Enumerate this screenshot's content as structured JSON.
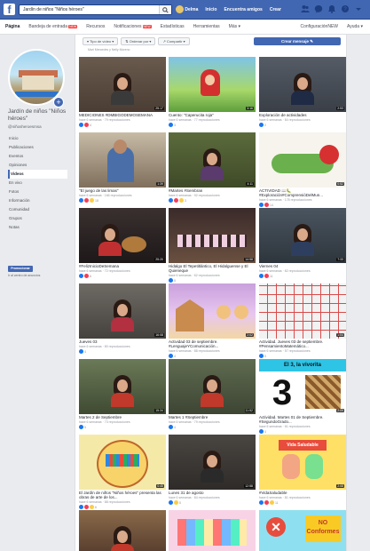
{
  "topbar": {
    "search_value": "Jardín de niños \"Niños héroes\"",
    "nav": [
      "Delma",
      "Inicio",
      "Encuentra amigos",
      "Crear"
    ],
    "icons": [
      "friends-icon",
      "messages-icon",
      "notifications-icon",
      "help-icon",
      "menu-icon"
    ]
  },
  "pagebar": {
    "tabs": [
      "Página",
      "Bandeja de entrada",
      "Recursos",
      "Notificaciones",
      "Estadísticas",
      "Herramientas",
      "Más"
    ],
    "new_label": "NEW",
    "right": [
      "Configuración",
      "Ayuda"
    ]
  },
  "sidebar": {
    "page_name": "Jardín de niños \"Niños héroes\"",
    "handle": "@niñosheroesmsa",
    "menu": [
      "Inicio",
      "Publicaciones",
      "Eventos",
      "Opiniones",
      "Videos",
      "En vivo",
      "Fotos",
      "Información",
      "Comunidad",
      "Grupos",
      "Notas"
    ],
    "active_index": 4,
    "promote_label": "Promocionar",
    "promote_note": "Ir al centro de anuncios"
  },
  "main": {
    "filter_labels": [
      "Tipo de vídeo",
      "Ordenar por",
      "Compartir"
    ],
    "create_label": "Crear mensaje",
    "top_caption": "Mari Mercedes y Nelly Moreno"
  },
  "videos": [
    {
      "title": "MEDICIONES #DMBIGODEMOSEMANA",
      "meta": "hace 6 semanas · 79 reproducciones",
      "dur": "25:17",
      "reacts": "4"
    },
    {
      "title": "Cuento: \"Caperucita roja\"",
      "meta": "hace 6 semanas · 77 reproducciones",
      "dur": "3:16",
      "reacts": "3"
    },
    {
      "title": "Exploración de actividades",
      "meta": "hace 6 semanas · 84 reproducciones",
      "dur": "2:53",
      "reacts": "2"
    },
    {
      "title": "\"El juego de las limas\"",
      "meta": "hace 6 semanas · 166 reproducciones",
      "dur": "1:39",
      "reacts": "18"
    },
    {
      "title": "#Martes #Sembran",
      "meta": "hace 6 semanas · 92 reproducciones",
      "dur": "4:11",
      "reacts": "3"
    },
    {
      "title": "ACTIVIDAD 📖🐛 #Exploración#ComprensióDelMun...",
      "meta": "hace 6 semanas · 178 reproducciones",
      "dur": "0:52",
      "reacts": "14"
    },
    {
      "title": "#FelizInicioDeSemana",
      "meta": "hace 6 semanas · 72 reproducciones",
      "dur": "25:20",
      "reacts": "6"
    },
    {
      "title": "Hidalgo El Tepetitlántico, El Hidalguense y El Quieneque",
      "meta": "hace 6 semanas · 62 reproducciones",
      "dur": "14:58",
      "reacts": "5"
    },
    {
      "title": "Viernes 04",
      "meta": "hace 6 semanas · 82 reproducciones",
      "dur": "7:33",
      "reacts": "11"
    },
    {
      "title": "Jueves 03",
      "meta": "hace 6 semanas · 80 reproducciones",
      "dur": "16:08",
      "reacts": "4"
    },
    {
      "title": "Actividad 03 de septiembre. #LenguajeYComunicación...",
      "meta": "hace 6 semanas · 88 reproducciones",
      "dur": "2:02",
      "reacts": "4"
    },
    {
      "title": "Actividad. Jueves 03 de septiembre. #PensamientoMatemático...",
      "meta": "hace 6 semanas · 57 reproducciones",
      "dur": "1:04",
      "reacts": "5"
    },
    {
      "title": "Martes 2 de Septiembre",
      "meta": "hace 6 semanas · 73 reproducciones",
      "dur": "15:34",
      "reacts": "5"
    },
    {
      "title": "Martes 1 #Septiembre",
      "meta": "hace 6 semanas · 79 reproducciones",
      "dur": "11:52",
      "reacts": "4"
    },
    {
      "title": "Actividad. Martes 01 de Septiembre. #SegundoGrado...",
      "meta": "hace 6 semanas · 61 reproducciones",
      "dur": "2:09",
      "reacts": "4",
      "thumb_text": [
        "El 3, la vivorita",
        "3"
      ]
    },
    {
      "title": "El Jardín de niños \"Niños héroes\" presenta las obras de arte de los...",
      "meta": "hace 6 semanas · 88 reproducciones",
      "dur": "0:45",
      "reacts": "6"
    },
    {
      "title": "Lunes 31 de agosto",
      "meta": "hace 6 semanas · 84 reproducciones",
      "dur": "12:58",
      "reacts": "5"
    },
    {
      "title": "#VidaSaludable",
      "meta": "hace 6 semanas · 81 reproducciones",
      "dur": "2:08",
      "reacts": "11",
      "thumb_text": [
        "Vida Saludable"
      ]
    },
    {
      "title": "",
      "meta": "",
      "dur": "",
      "reacts": ""
    },
    {
      "title": "",
      "meta": "",
      "dur": "",
      "reacts": ""
    },
    {
      "title": "",
      "meta": "",
      "dur": "",
      "reacts": "",
      "thumb_text": [
        "NO",
        "Conformes"
      ]
    }
  ]
}
